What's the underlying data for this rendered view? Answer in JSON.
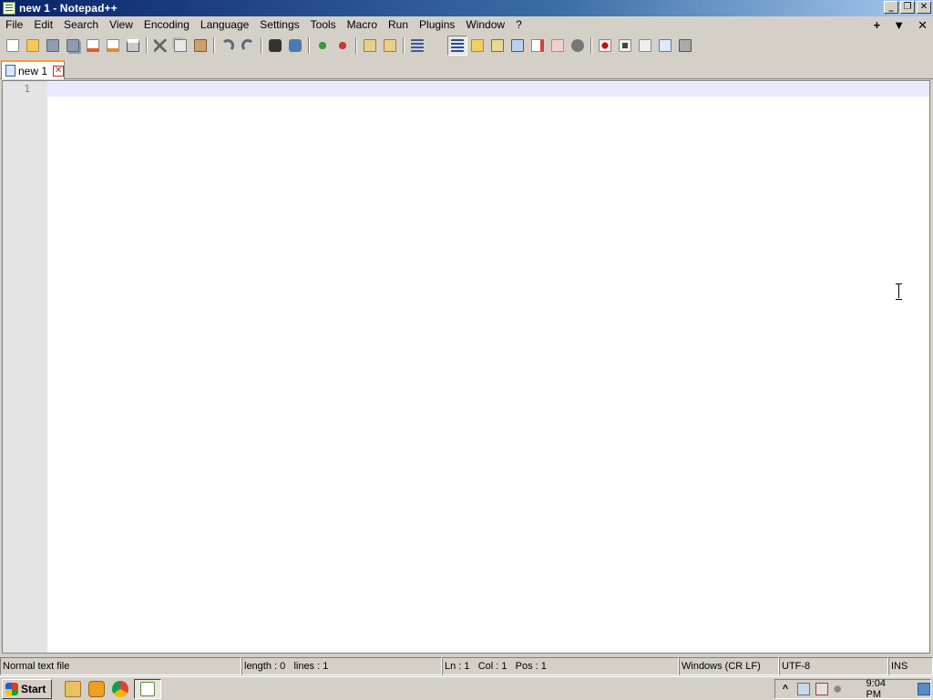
{
  "window": {
    "title": "new 1 - Notepad++",
    "buttons": {
      "minimize": "_",
      "restore": "❐",
      "close": "✕"
    }
  },
  "menu": {
    "items": [
      "File",
      "Edit",
      "Search",
      "View",
      "Encoding",
      "Language",
      "Settings",
      "Tools",
      "Macro",
      "Run",
      "Plugins",
      "Window",
      "?"
    ],
    "right": {
      "add": "+",
      "dropdown": "▼",
      "close": "✕"
    }
  },
  "toolbar": {
    "icons": [
      "new-file-icon",
      "open-file-icon",
      "save-icon",
      "save-all-icon",
      "close-icon",
      "close-all-icon",
      "print-icon",
      "cut-icon",
      "copy-icon",
      "paste-icon",
      "undo-icon",
      "redo-icon",
      "find-icon",
      "replace-icon",
      "zoom-in-icon",
      "zoom-out-icon",
      "sync-vertical-icon",
      "sync-horizontal-icon",
      "word-wrap-icon",
      "show-all-chars-icon",
      "indent-guide-icon",
      "user-language-icon",
      "document-map-icon",
      "function-list-icon",
      "folder-workspace-icon",
      "monitoring-icon",
      "toggle-panel-icon",
      "macro-record-icon",
      "macro-stop-icon",
      "macro-play-icon",
      "macro-run-multiple-icon",
      "macro-save-icon"
    ],
    "active": "indent-guide-icon"
  },
  "tabs": [
    {
      "label": "new 1",
      "active": true
    }
  ],
  "editor": {
    "line_numbers": [
      "1"
    ],
    "content": ""
  },
  "status": {
    "file_type": "Normal text file",
    "length": "length : 0",
    "lines": "lines : 1",
    "ln": "Ln : 1",
    "col": "Col : 1",
    "pos": "Pos : 1",
    "eol": "Windows (CR LF)",
    "encoding": "UTF-8",
    "mode": "INS"
  },
  "taskbar": {
    "start_label": "Start",
    "quick_launch": [
      "file-explorer-icon",
      "media-player-icon",
      "chrome-icon"
    ],
    "active_task": "notepadpp-icon",
    "tray_icons": [
      "show-hidden-icon",
      "network-icon",
      "action-center-icon",
      "volume-icon"
    ],
    "clock": "9:04 PM"
  },
  "colors": {
    "titlebar_start": "#0a246a",
    "tab_accent": "#fa9d2b",
    "current_line": "#e8e8ff",
    "gutter": "#e4e4e4"
  }
}
